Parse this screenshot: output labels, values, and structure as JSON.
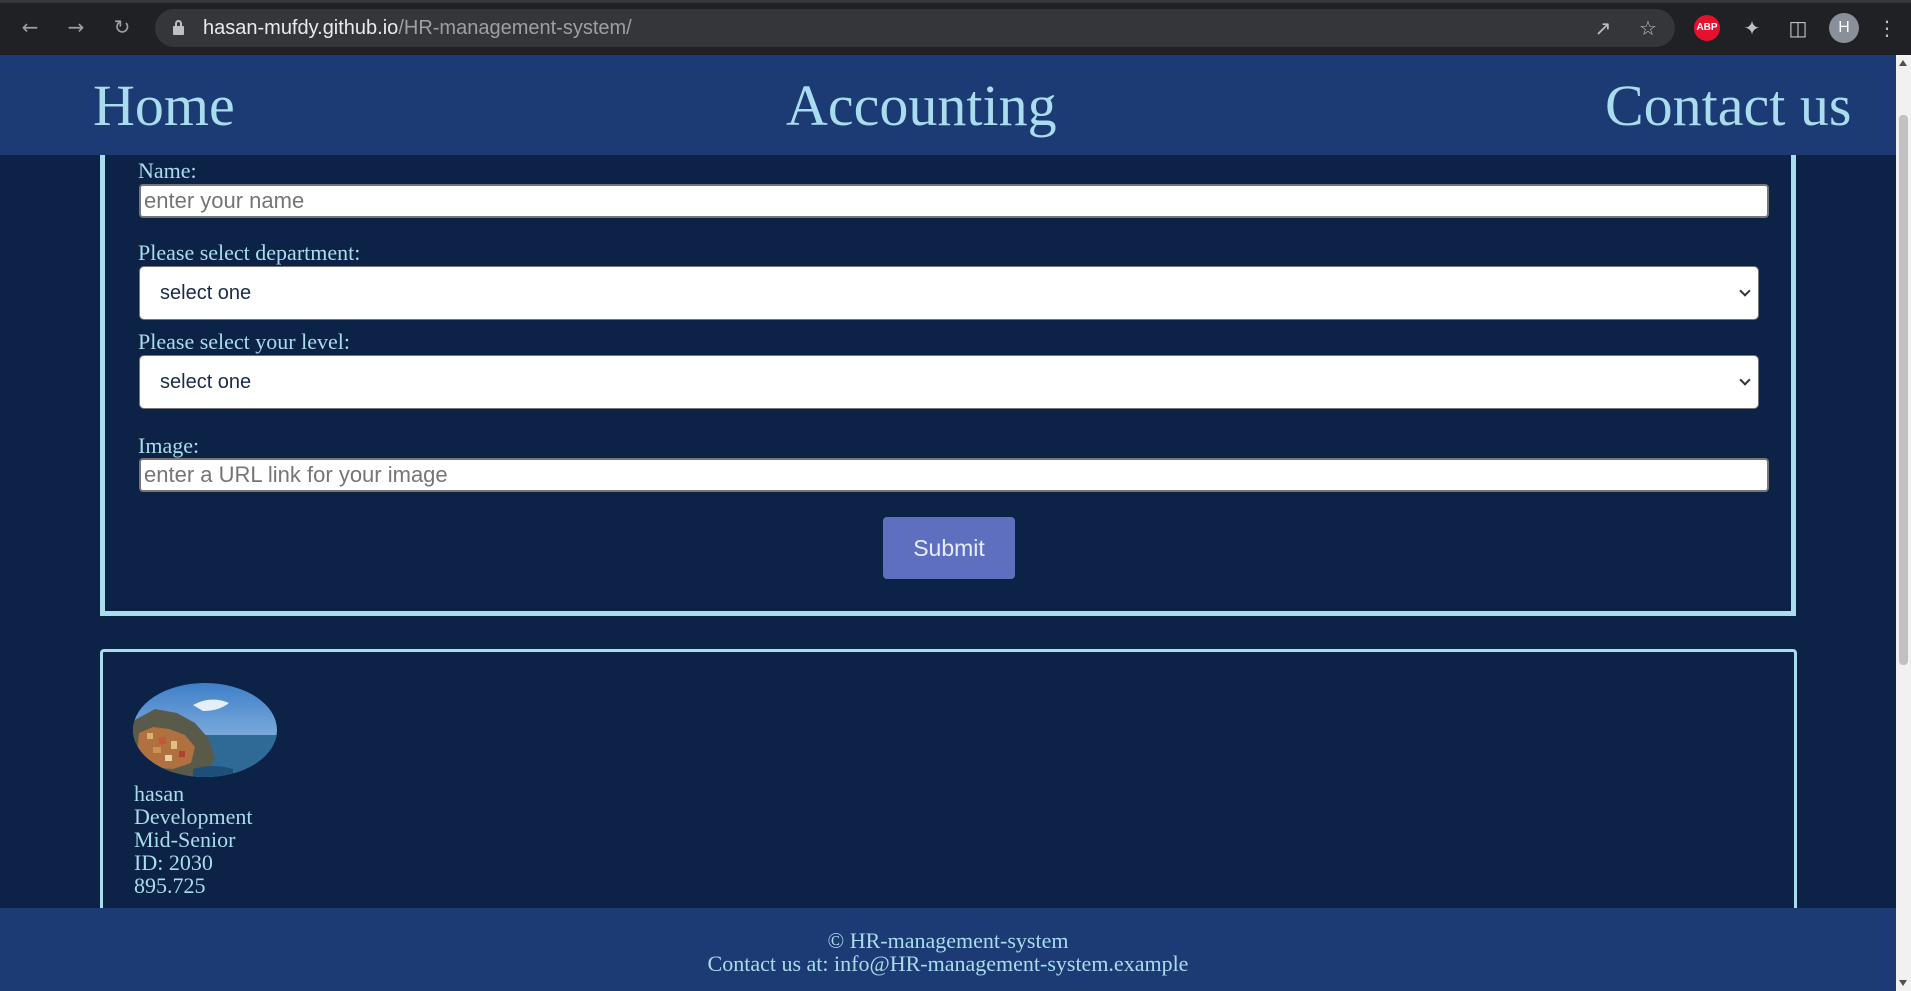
{
  "browser": {
    "url_host": "hasan-mufdy.github.io",
    "url_path": "/HR-management-system/",
    "profile_initial": "H",
    "adblock_label": "ABP"
  },
  "nav": {
    "home": "Home",
    "accounting": "Accounting",
    "contact": "Contact us"
  },
  "form": {
    "name_label": "Name:",
    "name_placeholder": "enter your name",
    "department_label": "Please select department:",
    "department_selected": "select one",
    "level_label": "Please select your level:",
    "level_selected": "select one",
    "image_label": "Image:",
    "image_placeholder": "enter a URL link for your image",
    "submit_label": "Submit"
  },
  "employee": {
    "name": "hasan",
    "department": "Development",
    "level": "Mid-Senior",
    "id": "ID: 2030",
    "salary": "895.725"
  },
  "footer": {
    "copyright": "© HR-management-system",
    "contact": "Contact us at: info@HR-management-system.example"
  },
  "colors": {
    "page_bg": "#0d2247",
    "bar_bg": "#1c3a73",
    "accent_text": "#a9dcec",
    "button_bg": "#5e6fc0"
  }
}
